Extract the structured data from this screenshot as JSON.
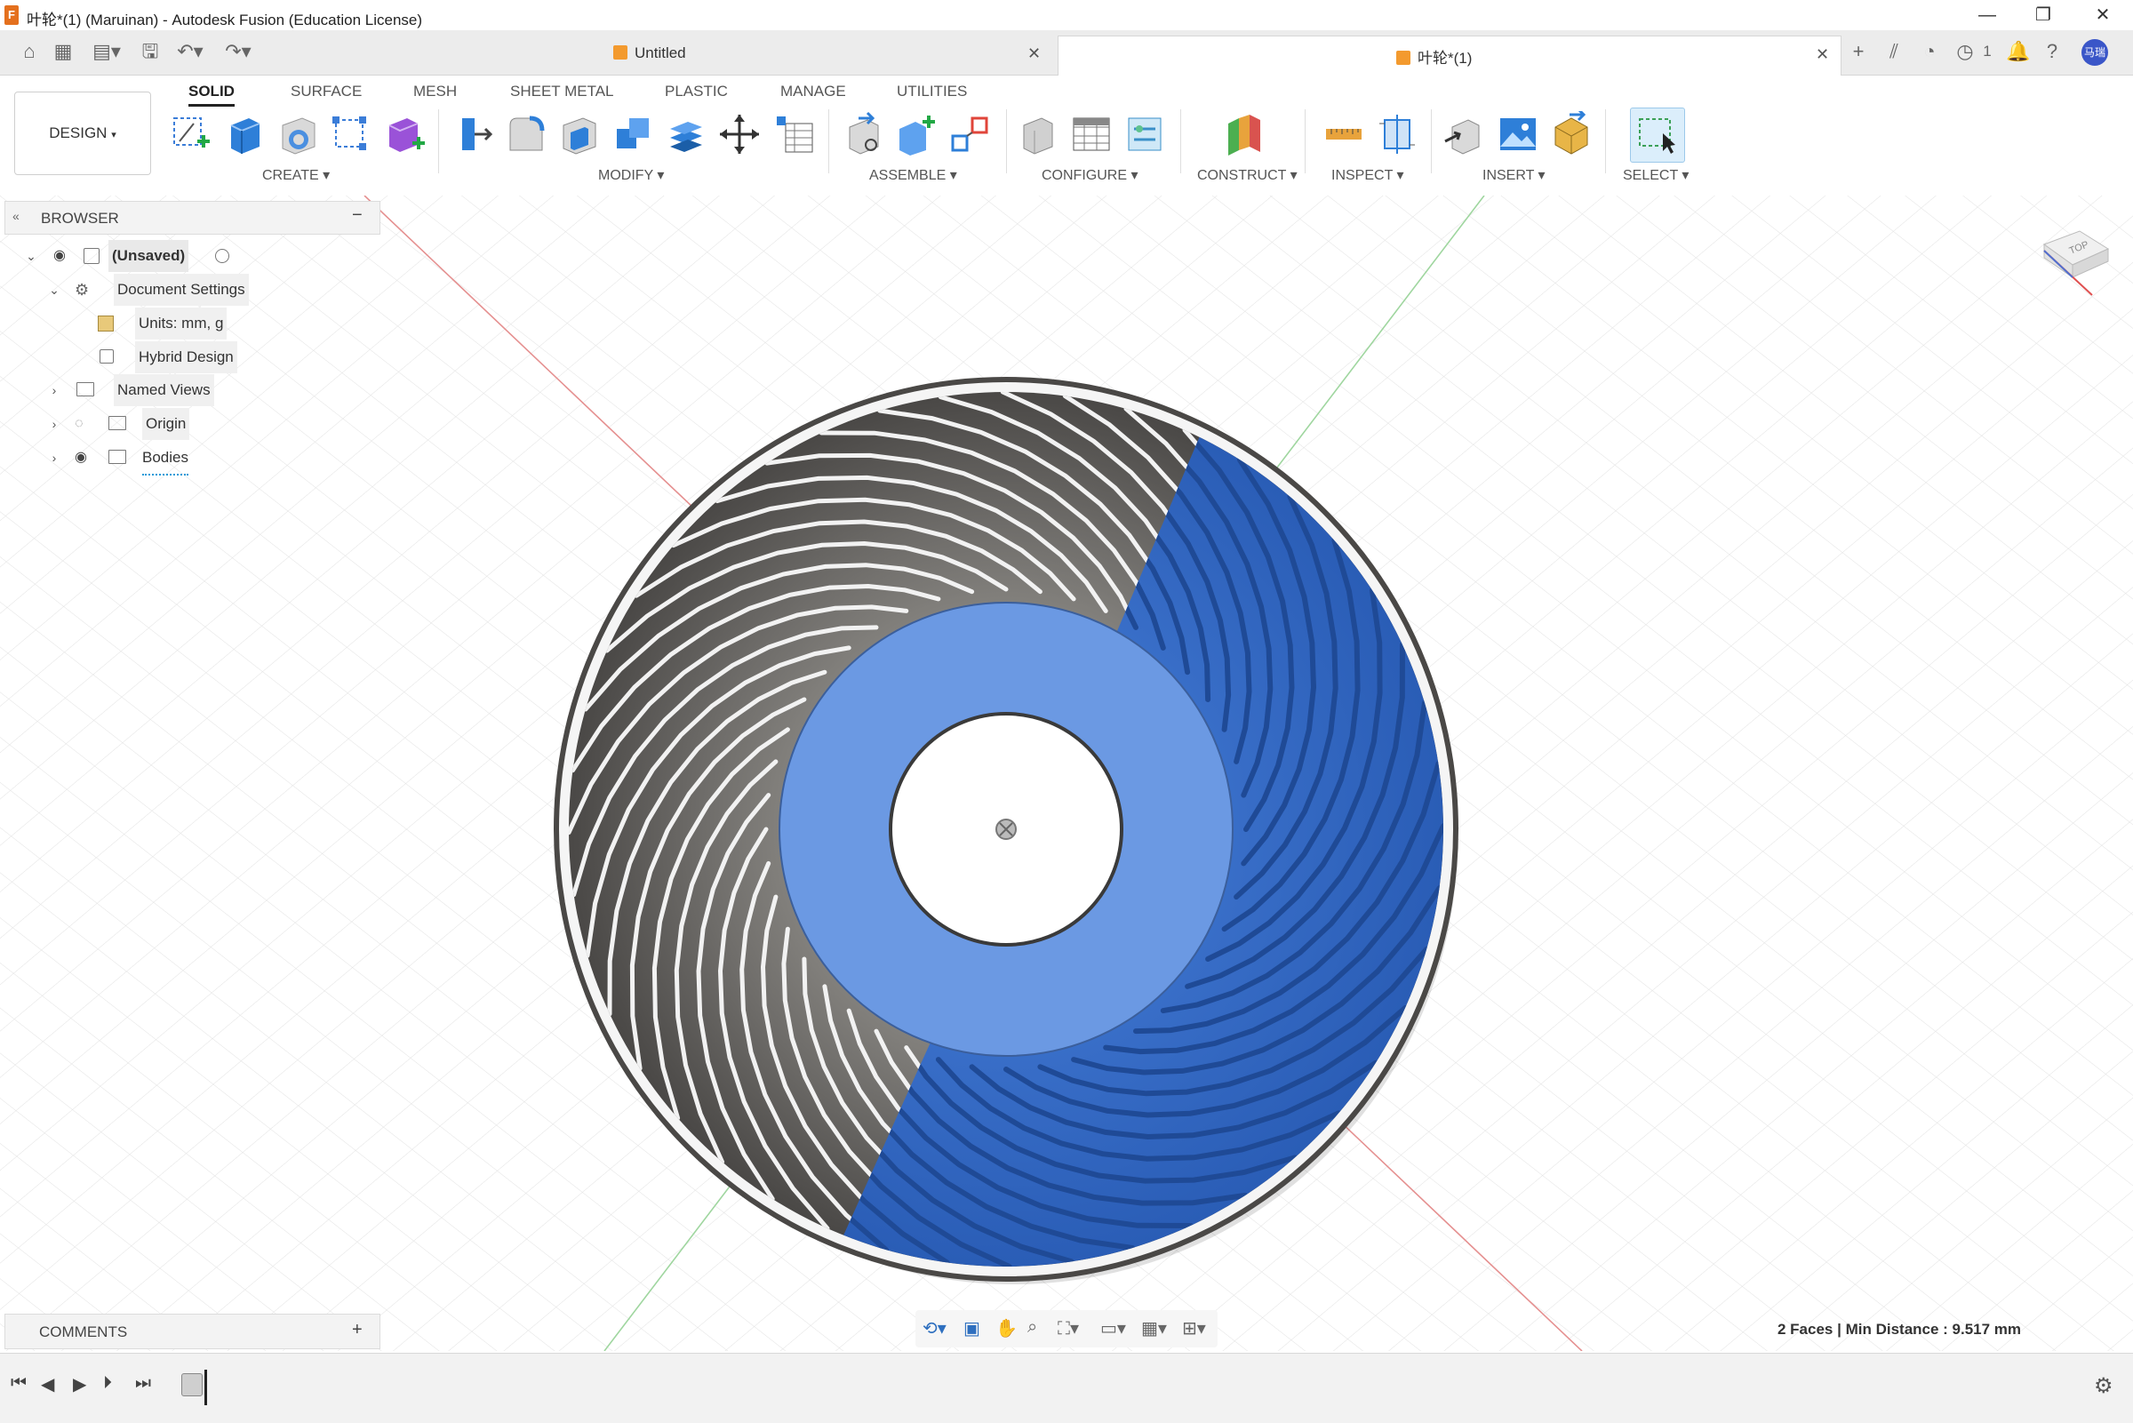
{
  "window": {
    "title": "叶轮*(1) (Maruinan) - Autodesk Fusion (Education License)",
    "minimize": "—",
    "restore": "❐",
    "close": "✕"
  },
  "tabs": [
    {
      "label": "Untitled",
      "close": "✕"
    },
    {
      "label": "叶轮*(1)",
      "close": "✕"
    }
  ],
  "quick": {
    "job_count": "1",
    "avatar": "马瑞"
  },
  "workspace": {
    "label": "DESIGN",
    "caret": "▾"
  },
  "ribbon_tabs": [
    "SOLID",
    "SURFACE",
    "MESH",
    "SHEET METAL",
    "PLASTIC",
    "MANAGE",
    "UTILITIES"
  ],
  "groups": [
    "CREATE ▾",
    "MODIFY ▾",
    "ASSEMBLE ▾",
    "CONFIGURE ▾",
    "CONSTRUCT ▾",
    "INSPECT ▾",
    "INSERT ▾",
    "SELECT ▾"
  ],
  "browser": {
    "title": "BROWSER",
    "collapse": "−",
    "root": "(Unsaved)",
    "document_settings": "Document Settings",
    "units": "Units: mm, g",
    "hybrid": "Hybrid Design",
    "named_views": "Named Views",
    "origin": "Origin",
    "bodies": "Bodies"
  },
  "viewcube": {
    "label": "TOP"
  },
  "comments": {
    "title": "COMMENTS",
    "add": "+"
  },
  "status": {
    "text": "2 Faces | Min Distance : 9.517 mm"
  },
  "colors": {
    "selection_blue": "#2f66c2",
    "highlight_blue": "#6f9ee8",
    "metal": "#7d7b78",
    "accent": "#0696d7"
  }
}
